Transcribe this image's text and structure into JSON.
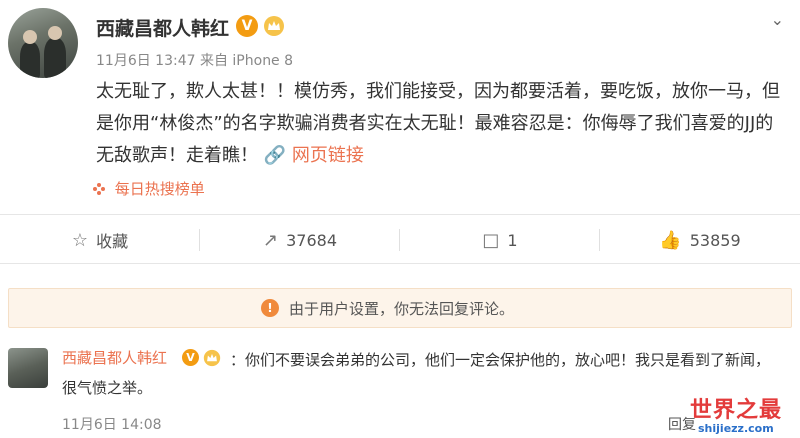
{
  "post": {
    "username": "西藏昌都人韩红",
    "verified_badge": "V",
    "meta": "11月6日 13:47 来自 iPhone 8",
    "content": "太无耻了，欺人太甚！！模仿秀，我们能接受，因为都要活着，要吃饭，放你一马，但是你用“林俊杰”的名字欺骗消费者实在太无耻！最难容忍是：你侮辱了我们喜爱的JJ的无敌歌声！走着瞧！",
    "web_link": "网页链接",
    "hot_list": "每日热搜榜单"
  },
  "actions": {
    "favorite": "收藏",
    "repost": "37684",
    "comment": "1",
    "like": "53859"
  },
  "notice": "由于用户设置，你无法回复评论。",
  "comment": {
    "username": "西藏昌都人韩红",
    "text": "：你们不要误会弟弟的公司，他们一定会保护他的，放心吧！我只是看到了新闻，很气愤之举。",
    "time": "11月6日 14:08",
    "reply": "回复"
  },
  "watermark": {
    "line1": "世界之最",
    "line2": "shijiezz.com"
  },
  "colors": {
    "accent": "#eb7350",
    "badge": "#f39c12",
    "notice_bg": "#fdf4ea"
  }
}
